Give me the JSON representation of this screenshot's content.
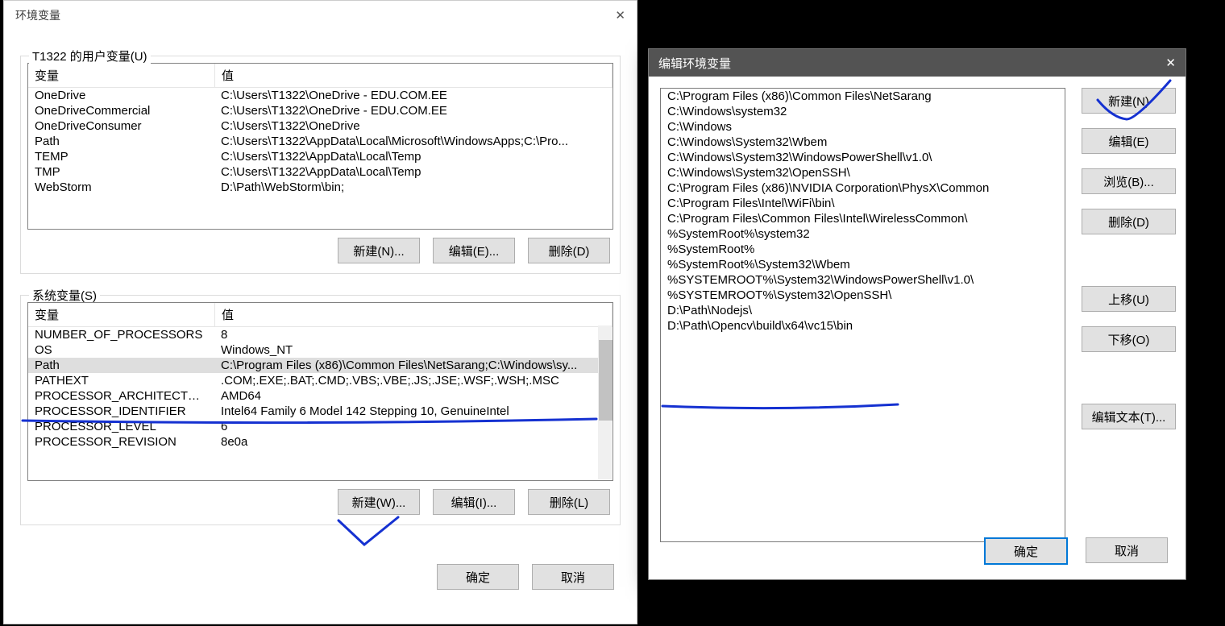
{
  "env": {
    "title": "环境变量",
    "user_section_legend": "T1322 的用户变量(U)",
    "system_section_legend": "系统变量(S)",
    "col_var": "变量",
    "col_val": "值",
    "user_vars": [
      {
        "name": "OneDrive",
        "value": "C:\\Users\\T1322\\OneDrive - EDU.COM.EE"
      },
      {
        "name": "OneDriveCommercial",
        "value": "C:\\Users\\T1322\\OneDrive - EDU.COM.EE"
      },
      {
        "name": "OneDriveConsumer",
        "value": "C:\\Users\\T1322\\OneDrive"
      },
      {
        "name": "Path",
        "value": "C:\\Users\\T1322\\AppData\\Local\\Microsoft\\WindowsApps;C:\\Pro..."
      },
      {
        "name": "TEMP",
        "value": "C:\\Users\\T1322\\AppData\\Local\\Temp"
      },
      {
        "name": "TMP",
        "value": "C:\\Users\\T1322\\AppData\\Local\\Temp"
      },
      {
        "name": "WebStorm",
        "value": "D:\\Path\\WebStorm\\bin;"
      }
    ],
    "user_btns": {
      "new": "新建(N)...",
      "edit": "编辑(E)...",
      "delete": "删除(D)"
    },
    "sys_vars": [
      {
        "name": "NUMBER_OF_PROCESSORS",
        "value": "8"
      },
      {
        "name": "OS",
        "value": "Windows_NT"
      },
      {
        "name": "Path",
        "value": "C:\\Program Files (x86)\\Common Files\\NetSarang;C:\\Windows\\sy..."
      },
      {
        "name": "PATHEXT",
        "value": ".COM;.EXE;.BAT;.CMD;.VBS;.VBE;.JS;.JSE;.WSF;.WSH;.MSC"
      },
      {
        "name": "PROCESSOR_ARCHITECTURE",
        "value": "AMD64"
      },
      {
        "name": "PROCESSOR_IDENTIFIER",
        "value": "Intel64 Family 6 Model 142 Stepping 10, GenuineIntel"
      },
      {
        "name": "PROCESSOR_LEVEL",
        "value": "6"
      },
      {
        "name": "PROCESSOR_REVISION",
        "value": "8e0a"
      }
    ],
    "sys_selected_index": 2,
    "sys_btns": {
      "new": "新建(W)...",
      "edit": "编辑(I)...",
      "delete": "删除(L)"
    },
    "footer": {
      "ok": "确定",
      "cancel": "取消"
    }
  },
  "edit": {
    "title": "编辑环境变量",
    "entries": [
      "C:\\Program Files (x86)\\Common Files\\NetSarang",
      "C:\\Windows\\system32",
      "C:\\Windows",
      "C:\\Windows\\System32\\Wbem",
      "C:\\Windows\\System32\\WindowsPowerShell\\v1.0\\",
      "C:\\Windows\\System32\\OpenSSH\\",
      "C:\\Program Files (x86)\\NVIDIA Corporation\\PhysX\\Common",
      "C:\\Program Files\\Intel\\WiFi\\bin\\",
      "C:\\Program Files\\Common Files\\Intel\\WirelessCommon\\",
      "%SystemRoot%\\system32",
      "%SystemRoot%",
      "%SystemRoot%\\System32\\Wbem",
      "%SYSTEMROOT%\\System32\\WindowsPowerShell\\v1.0\\",
      "%SYSTEMROOT%\\System32\\OpenSSH\\",
      "D:\\Path\\Nodejs\\",
      "D:\\Path\\Opencv\\build\\x64\\vc15\\bin"
    ],
    "btns": {
      "new": "新建(N)",
      "edit": "编辑(E)",
      "browse": "浏览(B)...",
      "delete": "删除(D)",
      "up": "上移(U)",
      "down": "下移(O)",
      "edit_text": "编辑文本(T)..."
    },
    "footer": {
      "ok": "确定",
      "cancel": "取消"
    }
  }
}
